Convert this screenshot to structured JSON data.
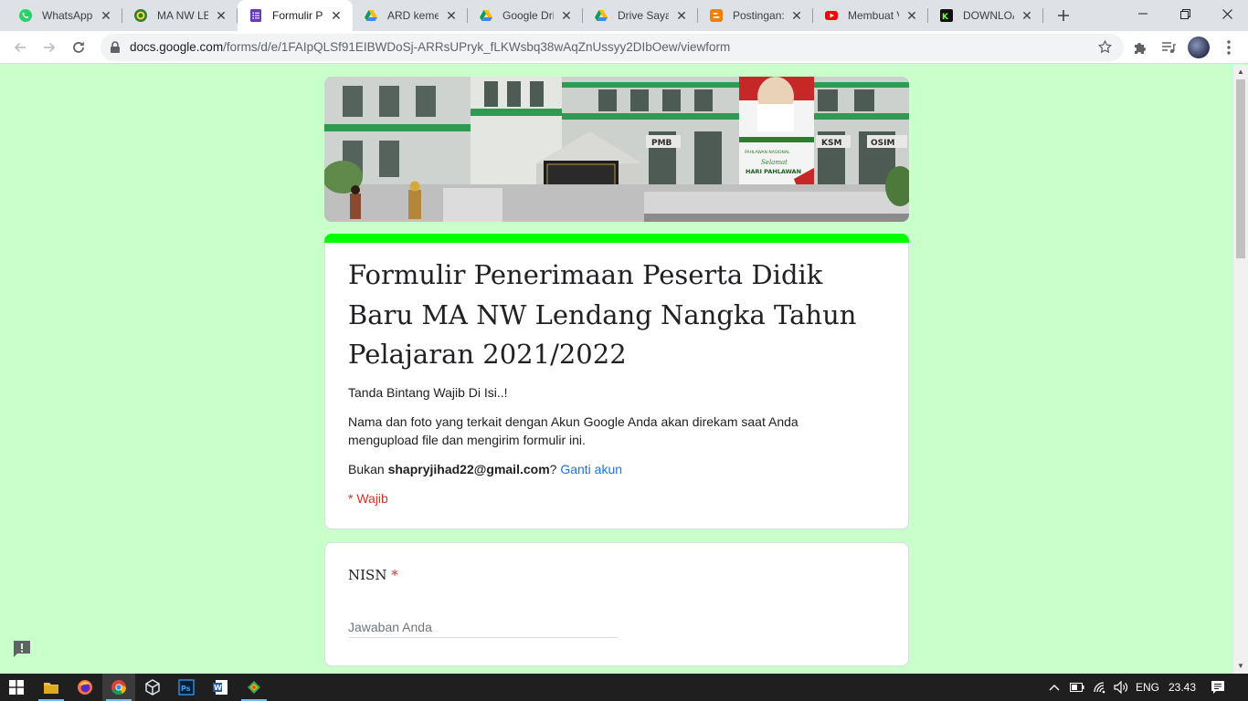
{
  "browser": {
    "tabs": [
      {
        "title": "WhatsApp",
        "icon": "whatsapp-icon"
      },
      {
        "title": "MA NW LENDANG NANGKA",
        "icon": "school-logo-icon"
      },
      {
        "title": "Formulir Penerimaan Peserta",
        "icon": "google-forms-icon"
      },
      {
        "title": "ARD kemenag",
        "icon": "google-drive-icon"
      },
      {
        "title": "Google Drive",
        "icon": "google-drive-icon"
      },
      {
        "title": "Drive Saya - Google Drive",
        "icon": "google-drive-icon"
      },
      {
        "title": "Postingan: Blogger",
        "icon": "blogger-icon"
      },
      {
        "title": "Membuat Video",
        "icon": "youtube-icon"
      },
      {
        "title": "DOWNLOAD",
        "icon": "kinemaster-icon"
      }
    ],
    "active_tab_index": 2,
    "url_host": "docs.google.com",
    "url_path": "/forms/d/e/1FAIpQLSf91EIBWDoSj-ARRsUPryk_fLKWsbq38wAqZnUssyy2DIbOew/viewform"
  },
  "form": {
    "title": "Formulir Penerimaan Peserta Didik Baru MA NW Lendang Nangka Tahun Pelajaran 2021/2022",
    "description": "Tanda Bintang Wajib Di Isi..!",
    "account_notice": "Nama dan foto yang terkait dengan Akun Google Anda akan direkam saat Anda mengupload file dan mengirim formulir ini.",
    "not_you_prefix": "Bukan",
    "email": "shapryjihad22@gmail.com",
    "not_you_suffix": "?",
    "switch_account": "Ganti akun",
    "required_note": "* Wajib",
    "accent_color": "#00ff00",
    "banner_texts": {
      "banner_line1": "PAHLAWAN NASIONAL",
      "banner_line2": "Selamat",
      "banner_line3": "HARI PAHLAWAN",
      "sign1": "PMB",
      "sign2": "KSM",
      "sign3": "OSIM"
    },
    "questions": [
      {
        "label": "NISN",
        "required_mark": "*",
        "placeholder": "Jawaban Anda"
      }
    ]
  },
  "taskbar": {
    "language": "ENG",
    "time": "23.43"
  }
}
